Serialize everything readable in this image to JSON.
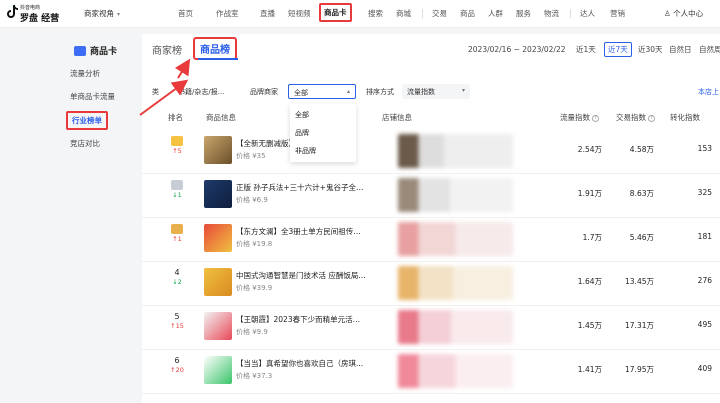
{
  "brand": {
    "small": "抖音电商",
    "big": "罗盘 经营"
  },
  "view_switch": "商家视角",
  "nav": [
    "首页",
    "作战室",
    "直播",
    "短视频",
    "商品卡",
    "搜索",
    "商城",
    "交易",
    "商品",
    "人群",
    "服务",
    "物流",
    "达人",
    "营销"
  ],
  "user": "个人中心",
  "sidebar": {
    "title": "商品卡",
    "items": [
      "流量分析",
      "单商品卡流量",
      "行业榜单",
      "竞店对比"
    ]
  },
  "tabs": [
    "商家榜",
    "商品榜"
  ],
  "date_range": "2023/02/16 ~ 2023/02/22",
  "range_buttons": [
    "近1天",
    "近7天",
    "近30天",
    "自然日",
    "自然周"
  ],
  "filters": {
    "category_label": "类",
    "category_value": "书籍/杂志/报...",
    "brand_label": "品牌商家",
    "brand_value": "全部",
    "sort_label": "排序方式",
    "sort_value": "流量指数",
    "store_link": "本店上"
  },
  "dropdown_options": [
    "全部",
    "品牌",
    "非品牌"
  ],
  "columns": {
    "rank": "排名",
    "product": "商品信息",
    "store": "店铺信息",
    "traffic": "流量指数",
    "trade": "交易指数",
    "conversion": "转化指数"
  },
  "rows": [
    {
      "rank": "",
      "change": "↑5",
      "dir": "up",
      "name": "【全新无删减版】...老...",
      "price": "价格 ¥35",
      "traffic": "2.54万",
      "trade": "4.58万",
      "conversion": "153"
    },
    {
      "rank": "",
      "change": "↓1",
      "dir": "down",
      "name": "正版 孙子兵法+三十六计+鬼谷子全3...",
      "price": "价格 ¥6.9",
      "traffic": "1.91万",
      "trade": "8.63万",
      "conversion": "325"
    },
    {
      "rank": "",
      "change": "↑1",
      "dir": "up",
      "name": "【东方文澜】全3册土单方民间祖传秘...",
      "price": "价格 ¥19.8",
      "traffic": "1.7万",
      "trade": "5.46万",
      "conversion": "181"
    },
    {
      "rank": "4",
      "change": "↓2",
      "dir": "down",
      "name": "中国式沟通智慧是门技术活 应酬饭局...",
      "price": "价格 ¥39.9",
      "traffic": "1.64万",
      "trade": "13.45万",
      "conversion": "276"
    },
    {
      "rank": "5",
      "change": "↑15",
      "dir": "up",
      "name": "【王朝霞】2023春下少而精单元活页...",
      "price": "价格 ¥9.9",
      "traffic": "1.45万",
      "trade": "17.31万",
      "conversion": "495"
    },
    {
      "rank": "6",
      "change": "↑20",
      "dir": "up",
      "name": "【当当】真希望你也喜欢自己（房琪...",
      "price": "价格 ¥37.3",
      "traffic": "1.41万",
      "trade": "17.95万",
      "conversion": "409"
    }
  ],
  "colors": {
    "accent": "#2b5fe8",
    "highlight": "#e83a3a",
    "up": "#e83a3a",
    "down": "#16a34a"
  }
}
